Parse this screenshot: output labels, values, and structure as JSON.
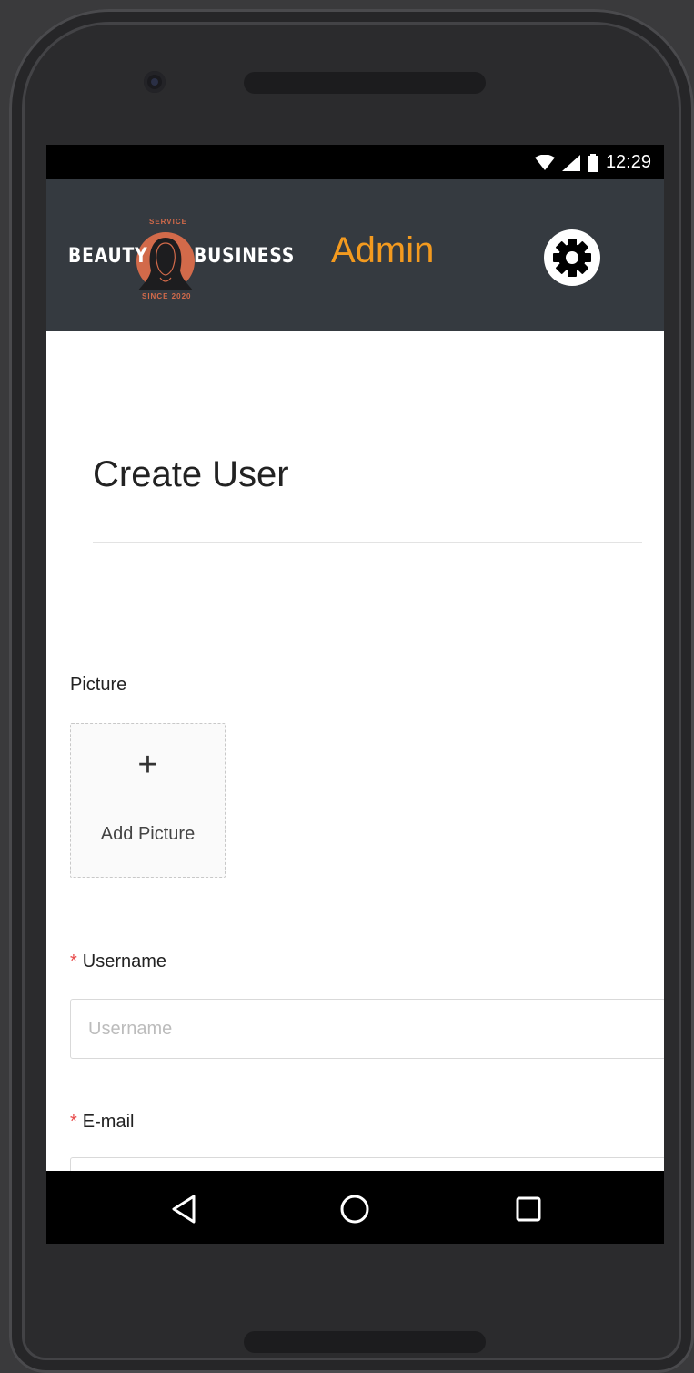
{
  "status_bar": {
    "time": "12:29"
  },
  "header": {
    "logo": {
      "top_text": "SERVICE",
      "left_word": "BEAUTY",
      "right_word": "BUSINESS",
      "bottom_text": "SINCE 2020"
    },
    "title": "Admin",
    "settings_icon": "gear-icon"
  },
  "form": {
    "heading": "Create User",
    "picture_label": "Picture",
    "add_picture_label": "Add Picture",
    "username_label": "Username",
    "username_placeholder": "Username",
    "username_value": "",
    "email_label": "E-mail",
    "required_marker": "*"
  },
  "nav": {
    "back_icon": "back-icon",
    "home_icon": "home-icon",
    "recents_icon": "recents-icon"
  },
  "colors": {
    "header_bg": "#353a40",
    "accent": "#f39a1f",
    "required": "#e84a4a",
    "logo_accent": "#d26a4a"
  }
}
